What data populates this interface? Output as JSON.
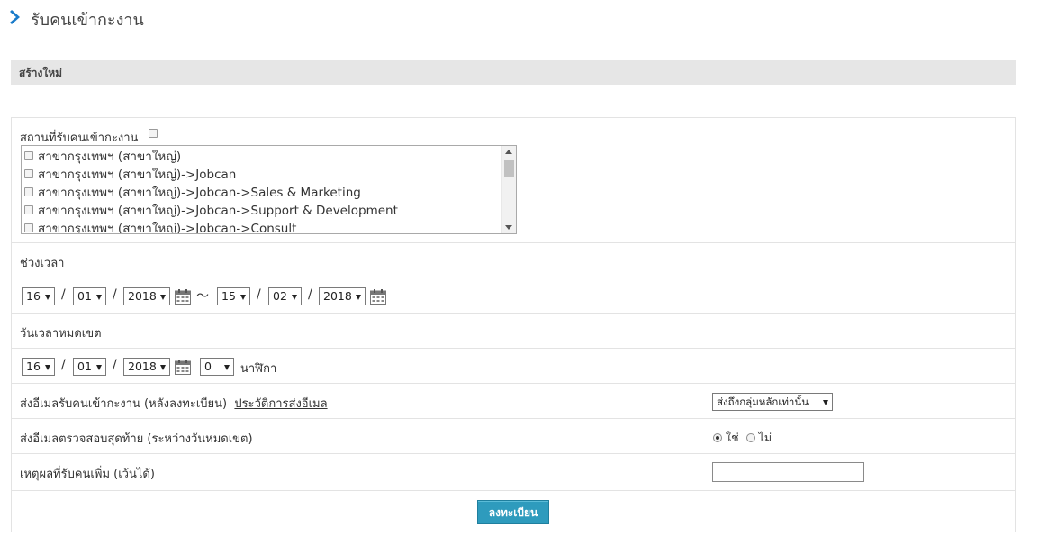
{
  "header": {
    "title": "รับคนเข้ากะงาน"
  },
  "section": {
    "label": "สร้างใหม่"
  },
  "locations": {
    "label": "สถานที่รับคนเข้ากะงาน",
    "items": [
      "สาขากรุงเทพฯ (สาขาใหญ่)",
      "สาขากรุงเทพฯ (สาขาใหญ่)->Jobcan",
      "สาขากรุงเทพฯ (สาขาใหญ่)->Jobcan->Sales & Marketing",
      "สาขากรุงเทพฯ (สาขาใหญ่)->Jobcan->Support & Development",
      "สาขากรุงเทพฯ (สาขาใหญ่)->Jobcan->Consult"
    ]
  },
  "period": {
    "label": "ช่วงเวลา",
    "from": {
      "day": "16",
      "month": "01",
      "year": "2018"
    },
    "tilde": "～",
    "to": {
      "day": "15",
      "month": "02",
      "year": "2018"
    },
    "sep": "/"
  },
  "deadline": {
    "label": "วันเวลาหมดเขต",
    "day": "16",
    "month": "01",
    "year": "2018",
    "minute": "0",
    "minute_unit": "นาฬิกา"
  },
  "email_notice": {
    "label": "ส่งอีเมลรับคนเข้ากะงาน (หลังลงทะเบียน)",
    "history_link": "ประวัติการส่งอีเมล",
    "select_value": "ส่งถึงกลุ่มหลักเท่านั้น"
  },
  "final_email": {
    "label": "ส่งอีเมลตรวจสอบสุดท้าย (ระหว่างวันหมดเขต)",
    "yes": "ใช่",
    "no": "ไม่"
  },
  "reason": {
    "label": "เหตุผลที่รับคนเพิ่ม (เว้นได้)",
    "value": ""
  },
  "submit_label": "ลงทะเบียน",
  "colors": {
    "accent": "#1a7bc9",
    "button": "#2e9bbd",
    "section_bg": "#e6e6e6"
  }
}
